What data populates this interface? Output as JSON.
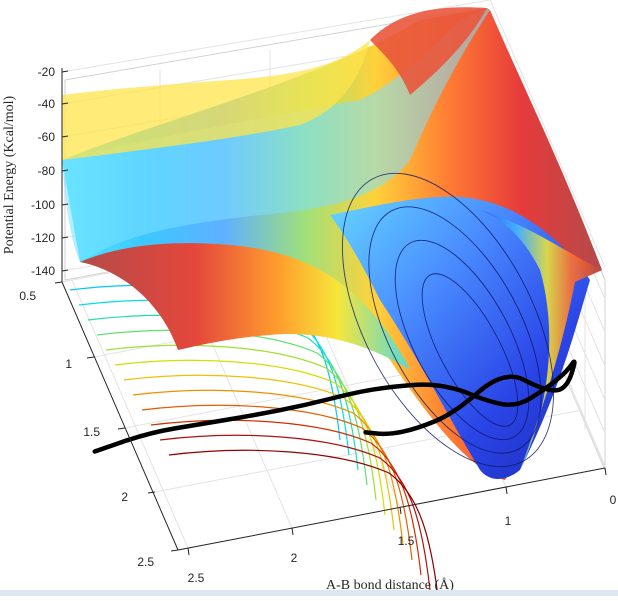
{
  "chart_data": {
    "type": "surface",
    "title": "",
    "xlabel": "A-B bond distance (Å)",
    "ylabel": "",
    "zlabel": "Potential Energy (Kcal/mol)",
    "z_ticks": [
      "-20",
      "-40",
      "-60",
      "-80",
      "-100",
      "-120",
      "-140"
    ],
    "ab_ticks": [
      "0",
      "1",
      "1.5",
      "2",
      "2.5"
    ],
    "bc_ticks": [
      "0.5",
      "1",
      "1.5",
      "2",
      "2.5"
    ],
    "zlim": [
      -140,
      -20
    ],
    "colormap": "jet",
    "grid": true,
    "contours_on_floor": true,
    "trajectory": {
      "color": "#000000",
      "ab": [
        3.0,
        2.7,
        2.4,
        2.1,
        1.8,
        1.5,
        1.3,
        1.1,
        0.95,
        0.85,
        0.7,
        0.55,
        0.45,
        0.4,
        0.45,
        0.55,
        0.75,
        1.0,
        1.2,
        1.35,
        1.45
      ],
      "bc": [
        0.65,
        0.7,
        0.72,
        0.74,
        0.75,
        0.76,
        0.78,
        0.82,
        0.9,
        1.0,
        1.12,
        1.22,
        1.28,
        1.3,
        1.26,
        1.18,
        1.08,
        0.95,
        0.9,
        0.85,
        0.75
      ],
      "energy": [
        -128,
        -118,
        -117,
        -116,
        -115,
        -112,
        -111,
        -110,
        -110,
        -110,
        -108,
        -90,
        -76,
        -66,
        -90,
        -95,
        -86,
        -120,
        -130,
        -135,
        -140
      ]
    }
  }
}
